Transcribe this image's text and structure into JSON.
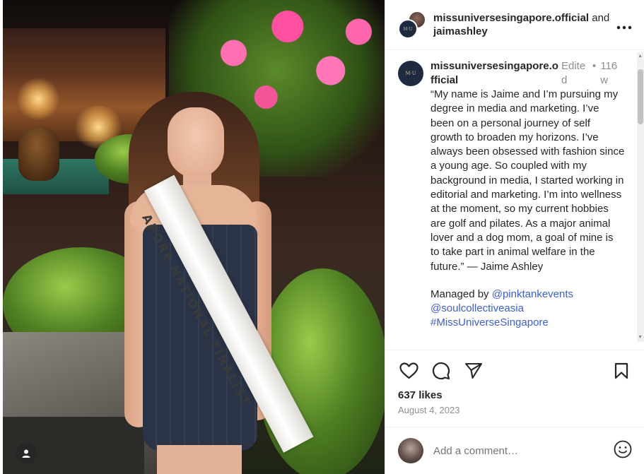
{
  "post": {
    "header": {
      "user1": "missuniversesingapore.official",
      "joiner": " and ",
      "user2": "jaimashley",
      "more_icon": "more-horizontal-icon"
    },
    "caption": {
      "username": "missuniversesingapore.official",
      "edited": "Edited",
      "dot": "•",
      "time": "116w",
      "text": "“My name is Jaime and I’m pursuing my degree in media and marketing. I’ve been on a personal journey of self growth to broaden my horizons. I’ve always been obsessed with fashion since a young age. So coupled with my background in media, I started working in editorial and marketing. I’m into wellness at the moment, so my current hobbies are golf and pilates. As a major animal lover and a dog mom, a goal of mine is to take part in animal welfare in the future.” — Jaime Ashley",
      "managed_prefix": "Managed by ",
      "mention1": "@pinktankevents",
      "mention2": "@soulcollectiveasia",
      "hashtag": "#MissUniverseSingapore"
    },
    "photo": {
      "sash_text": "APORE NATIONAL FINALIST"
    },
    "actions": {
      "like_icon": "heart-icon",
      "comment_icon": "comment-icon",
      "share_icon": "share-icon",
      "save_icon": "bookmark-icon",
      "likes": "637 likes",
      "date": "August 4, 2023"
    },
    "comment": {
      "placeholder": "Add a comment…",
      "emoji_icon": "emoji-icon"
    }
  },
  "colors": {
    "link": "#3d5ed6",
    "muted": "#8e8e8e",
    "text": "#262626"
  }
}
